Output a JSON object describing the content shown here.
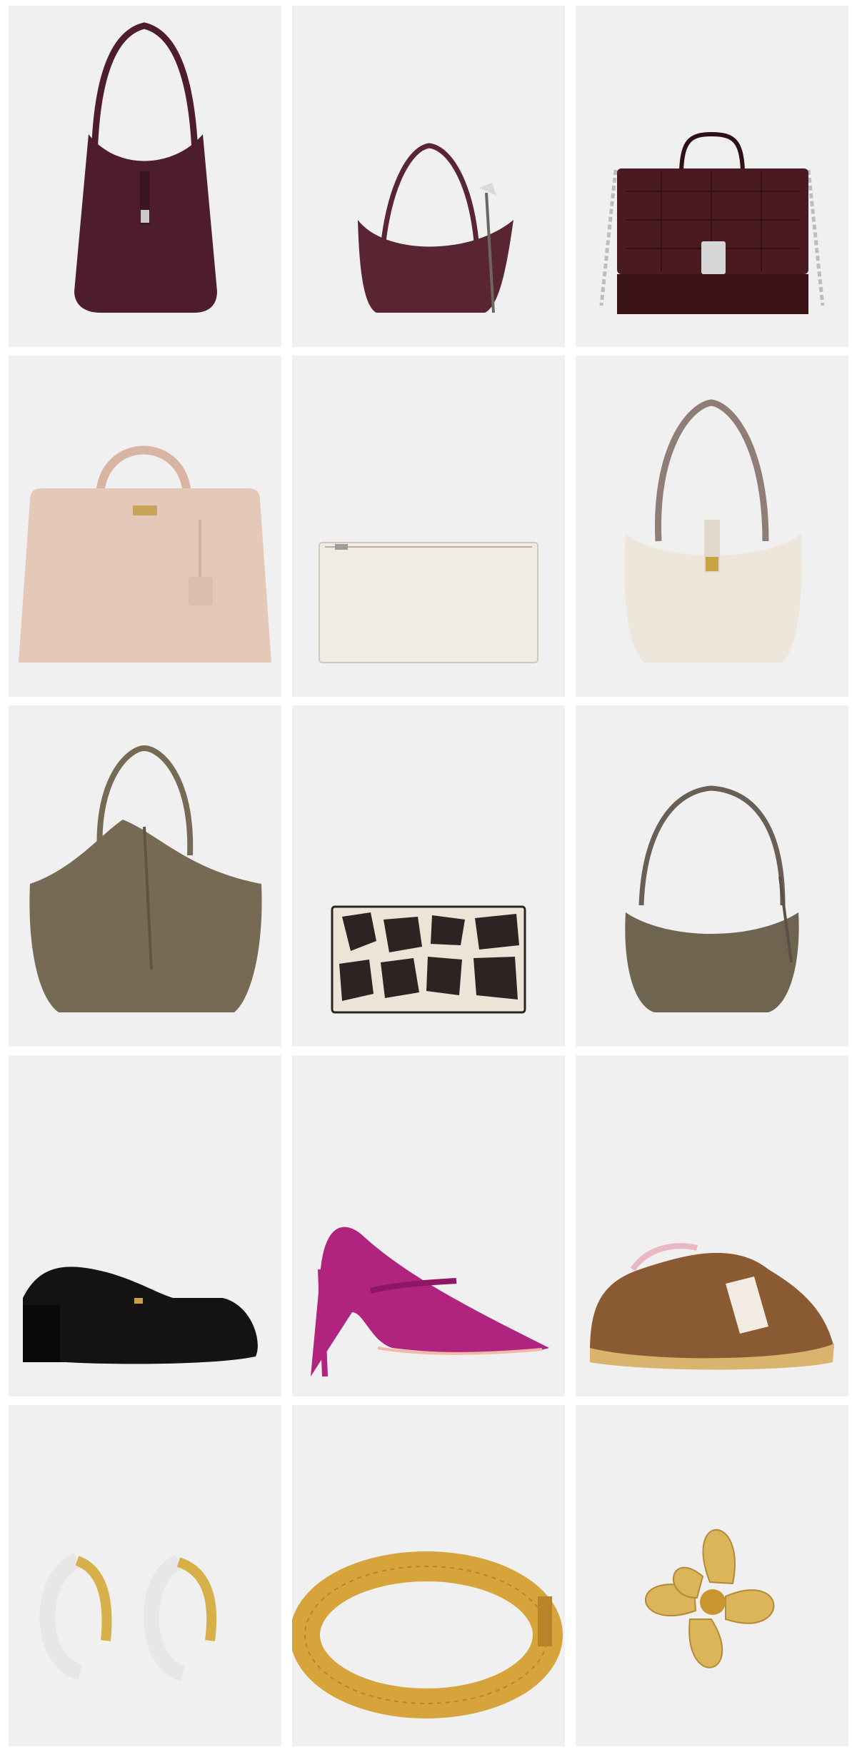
{
  "grid": {
    "columns": 3,
    "rows": 5,
    "tile_background": "#f0f0f0",
    "page_background": "#ffffff",
    "products": [
      {
        "name": "burgundy-hobo-shoulder-bag",
        "kind": "hobo",
        "color": "#4e1d2b"
      },
      {
        "name": "burgundy-suede-mini-hobo",
        "kind": "minihobo",
        "color": "#5a2532"
      },
      {
        "name": "burgundy-croc-chain-crossbody",
        "kind": "chainbag",
        "color": "#4a1a22"
      },
      {
        "name": "blush-leather-satchel",
        "kind": "satchel",
        "color": "#e5c9b8"
      },
      {
        "name": "cream-leather-pouch",
        "kind": "pouch",
        "color": "#f1ece3"
      },
      {
        "name": "cream-hobo-shoulder-bag",
        "kind": "creamhobo",
        "color": "#ece6db"
      },
      {
        "name": "olive-suede-tote",
        "kind": "tote",
        "color": "#776a55"
      },
      {
        "name": "giraffe-print-wallet",
        "kind": "wallet",
        "color": "#2f2223"
      },
      {
        "name": "olive-suede-crescent-bag",
        "kind": "crescent",
        "color": "#6f6450"
      },
      {
        "name": "black-heeled-loafer",
        "kind": "loafer",
        "color": "#141212"
      },
      {
        "name": "magenta-suede-pump",
        "kind": "pump",
        "color": "#b0237f"
      },
      {
        "name": "giraffe-print-sneaker",
        "kind": "sneaker",
        "color": "#8a5a33"
      },
      {
        "name": "lucite-gold-hoop-earrings",
        "kind": "earrings",
        "color": "#d8b04a"
      },
      {
        "name": "gold-filigree-bangle",
        "kind": "bangle",
        "color": "#d6a43a"
      },
      {
        "name": "gold-flower-brooch",
        "kind": "brooch",
        "color": "#dcb45a"
      }
    ]
  }
}
